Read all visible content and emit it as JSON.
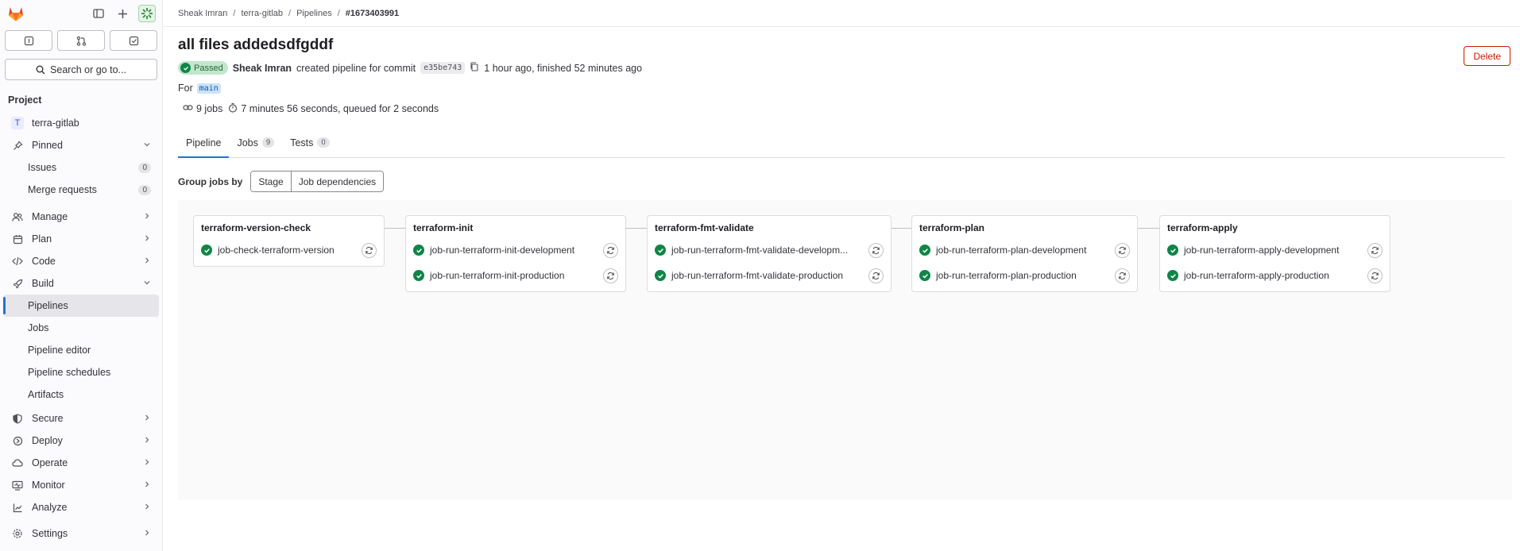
{
  "sidebar": {
    "search_label": "Search or go to...",
    "section_title": "Project",
    "project": {
      "initial": "T",
      "name": "terra-gitlab"
    },
    "pinned": {
      "label": "Pinned",
      "issues_label": "Issues",
      "issues_count": "0",
      "mr_label": "Merge requests",
      "mr_count": "0"
    },
    "nav": {
      "manage": "Manage",
      "plan": "Plan",
      "code": "Code",
      "build": "Build",
      "build_items": [
        "Pipelines",
        "Jobs",
        "Pipeline editor",
        "Pipeline schedules",
        "Artifacts"
      ],
      "secure": "Secure",
      "deploy": "Deploy",
      "operate": "Operate",
      "monitor": "Monitor",
      "analyze": "Analyze",
      "settings": "Settings"
    }
  },
  "breadcrumb": [
    "Sheak Imran",
    "terra-gitlab",
    "Pipelines",
    "#1673403991"
  ],
  "pipeline": {
    "title": "all files addedsdfgddf",
    "delete_label": "Delete",
    "status": "Passed",
    "author": "Sheak Imran",
    "created_text": "created pipeline for commit",
    "commit": "e35be743",
    "time_text": "1 hour ago, finished 52 minutes ago",
    "for_label": "For",
    "ref": "main",
    "jobs_count_text": "9 jobs",
    "duration_text": "7 minutes 56 seconds, queued for 2 seconds"
  },
  "tabs": [
    {
      "label": "Pipeline",
      "count": ""
    },
    {
      "label": "Jobs",
      "count": "9"
    },
    {
      "label": "Tests",
      "count": "0"
    }
  ],
  "group_by": {
    "label": "Group jobs by",
    "options": [
      "Stage",
      "Job dependencies"
    ]
  },
  "stages": [
    {
      "name": "terraform-version-check",
      "jobs": [
        "job-check-terraform-version"
      ]
    },
    {
      "name": "terraform-init",
      "jobs": [
        "job-run-terraform-init-development",
        "job-run-terraform-init-production"
      ]
    },
    {
      "name": "terraform-fmt-validate",
      "jobs": [
        "job-run-terraform-fmt-validate-developm...",
        "job-run-terraform-fmt-validate-production"
      ]
    },
    {
      "name": "terraform-plan",
      "jobs": [
        "job-run-terraform-plan-development",
        "job-run-terraform-plan-production"
      ]
    },
    {
      "name": "terraform-apply",
      "jobs": [
        "job-run-terraform-apply-development",
        "job-run-terraform-apply-production"
      ]
    }
  ],
  "colors": {
    "success": "#108548",
    "accent": "#1f75cb",
    "danger": "#c91c00"
  }
}
